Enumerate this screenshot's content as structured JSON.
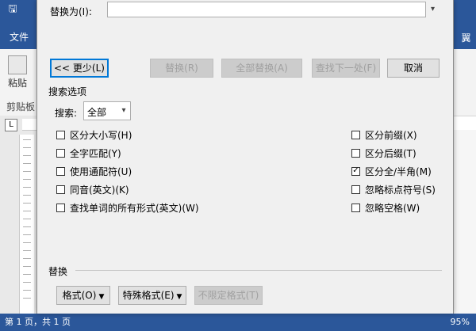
{
  "word": {
    "file_tab": "文件",
    "right_edge_tab": "翼",
    "paste_label": "粘贴",
    "clipboard_label": "剪贴板",
    "ruler_tab": "L",
    "status_page": "第 1 页，共 1 页",
    "status_zoom": "95%"
  },
  "dialog": {
    "replace_with_label": "替换为(I):",
    "replace_with_value": "",
    "buttons": {
      "less": "<< 更少(L)",
      "replace": "替换(R)",
      "replace_all": "全部替换(A)",
      "find_next": "查找下一处(F)",
      "cancel": "取消"
    },
    "search_options_label": "搜索选项",
    "search_label": "搜索:",
    "search_value": "全部",
    "options_left": [
      {
        "label": "区分大小写(H)",
        "checked": false
      },
      {
        "label": "全字匹配(Y)",
        "checked": false
      },
      {
        "label": "使用通配符(U)",
        "checked": false
      },
      {
        "label": "同音(英文)(K)",
        "checked": false
      },
      {
        "label": "查找单词的所有形式(英文)(W)",
        "checked": false
      }
    ],
    "options_right": [
      {
        "label": "区分前缀(X)",
        "checked": false
      },
      {
        "label": "区分后缀(T)",
        "checked": false
      },
      {
        "label": "区分全/半角(M)",
        "checked": true
      },
      {
        "label": "忽略标点符号(S)",
        "checked": false
      },
      {
        "label": "忽略空格(W)",
        "checked": false
      }
    ],
    "replace_section_label": "替换",
    "format_button": "格式(O)",
    "special_button": "特殊格式(E)",
    "no_format_button": "不限定格式(T)"
  },
  "colors": {
    "word_blue": "#2b579a",
    "focus_blue": "#0078d7",
    "dialog_bg": "#f0f0f0"
  }
}
